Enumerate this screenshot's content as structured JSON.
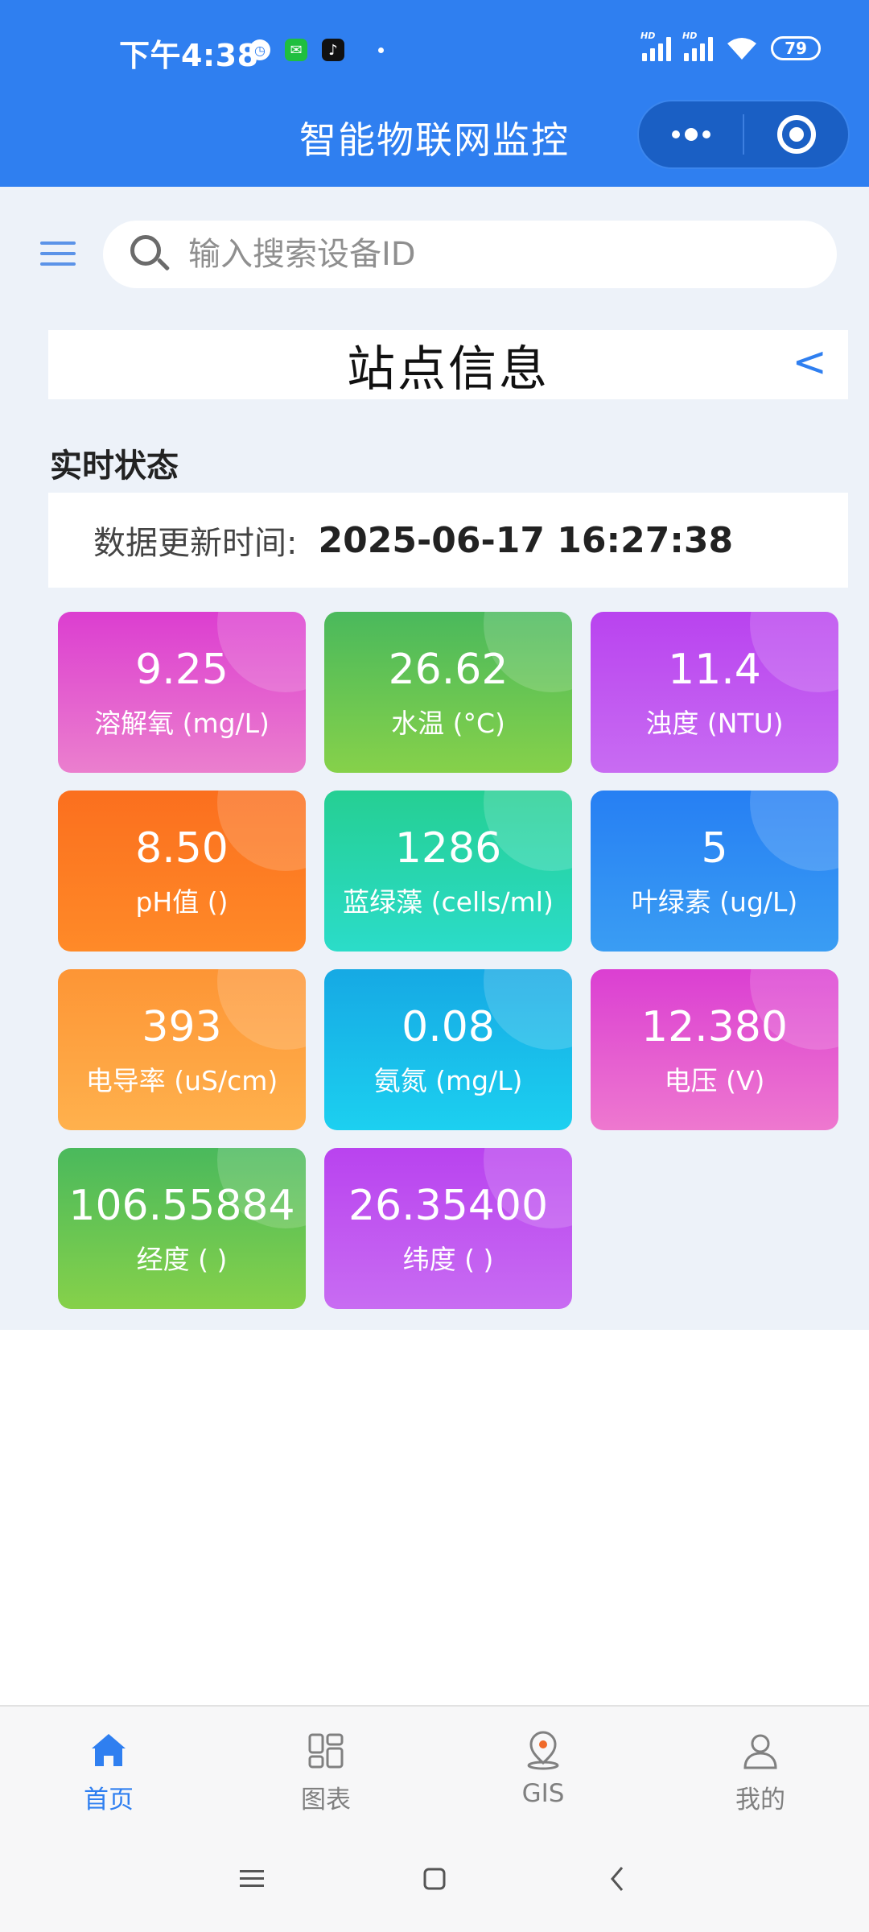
{
  "status_bar": {
    "time": "下午4:38",
    "battery": "79",
    "signal_label": "HD"
  },
  "header": {
    "title": "智能物联网监控"
  },
  "search": {
    "placeholder": "输入搜索设备ID"
  },
  "station": {
    "title": "站点信息",
    "back_symbol": "<"
  },
  "realtime": {
    "section_title": "实时状态",
    "update_label": "数据更新时间:",
    "update_time": "2025-06-17 16:27:38"
  },
  "metrics": [
    {
      "value": "9.25",
      "label": "溶解氧 (mg/L)",
      "color": "#dc3ed0"
    },
    {
      "value": "26.62",
      "label": "水温 (°C)",
      "color": "#4ab95c"
    },
    {
      "value": "11.4",
      "label": "浊度 (NTU)",
      "color": "#b943ef"
    },
    {
      "value": "8.50",
      "label": "pH值 ()",
      "color": "#fb6f1e"
    },
    {
      "value": "1286",
      "label": "蓝绿藻 (cells/ml)",
      "color": "#25cf93"
    },
    {
      "value": "5",
      "label": "叶绿素 (ug/L)",
      "color": "#267ff3"
    },
    {
      "value": "393",
      "label": "电导率 (uS/cm)",
      "color": "#fd9535"
    },
    {
      "value": "0.08",
      "label": "氨氮 (mg/L)",
      "color": "#16a9e4"
    },
    {
      "value": "12.380",
      "label": "电压 (V)",
      "color": "#db3fd2"
    },
    {
      "value": "106.55884",
      "label": "经度 ( )",
      "color": "#4ab95c"
    },
    {
      "value": "26.35400",
      "label": "纬度 ( )",
      "color": "#b943ef"
    }
  ],
  "tabs": [
    {
      "label": "首页",
      "icon": "home-icon",
      "active": true
    },
    {
      "label": "图表",
      "icon": "chart-grid-icon",
      "active": false
    },
    {
      "label": "GIS",
      "icon": "map-pin-icon",
      "active": false
    },
    {
      "label": "我的",
      "icon": "user-icon",
      "active": false
    }
  ],
  "colors": {
    "primary": "#2f7ff0",
    "background": "#edf2f9"
  }
}
